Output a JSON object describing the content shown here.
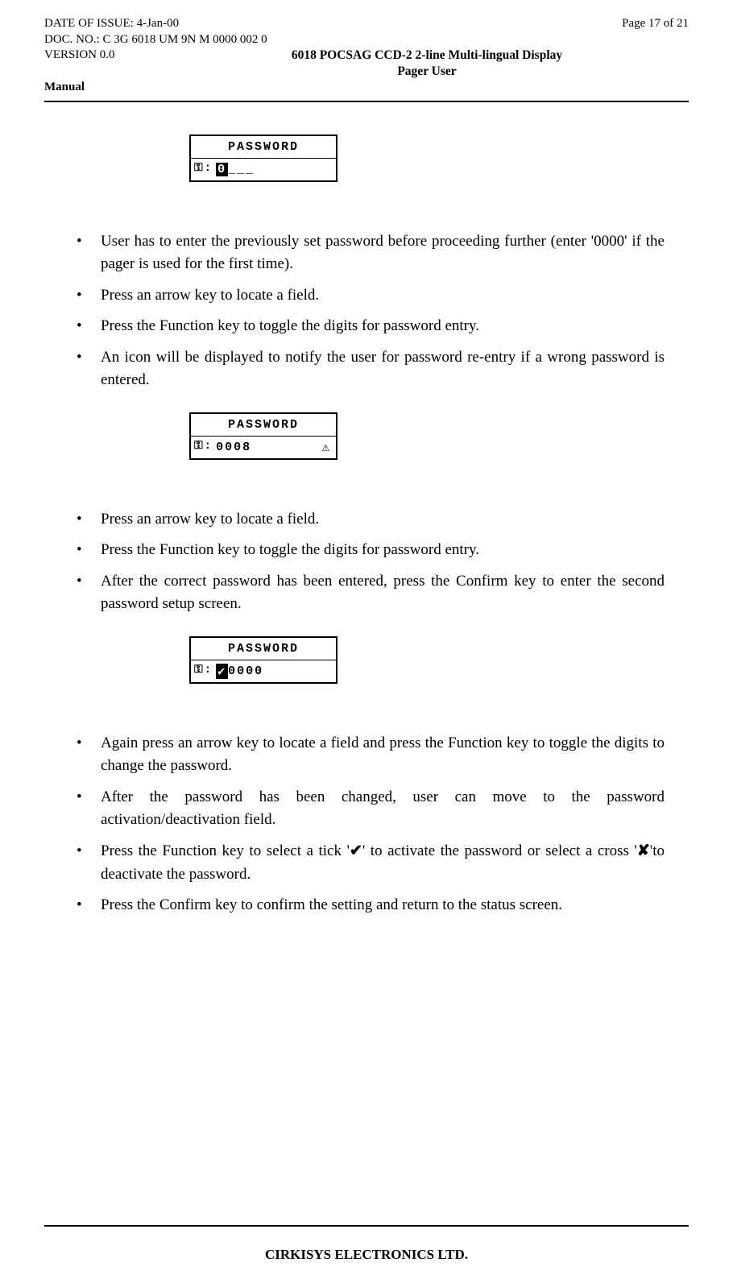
{
  "header": {
    "date_label": "DATE OF ISSUE: 4-Jan-00",
    "page_label": "Page 17 of 21",
    "doc_no": "DOC. NO.: C 3G 6018 UM 9N M 0000 002 0",
    "version": "VERSION 0.0",
    "title": "6018 POCSAG CCD-2 2-line Multi-lingual Display Pager User",
    "manual": "Manual"
  },
  "lcd1": {
    "top": "PASSWORD",
    "bottom_key": "⚿:",
    "bottom_val_inv": "0",
    "bottom_val_rest": "___"
  },
  "bullets1": {
    "b0": "User has to enter the previously set password before proceeding further (enter '0000' if the pager is used for the first time).",
    "b1": "Press an arrow key to locate a field.",
    "b2": "Press the Function key to toggle the digits for password entry.",
    "b3": "An icon will be displayed to notify the user for password re-entry if a wrong password is entered."
  },
  "lcd2": {
    "top": "PASSWORD",
    "bottom_key": "⚿:",
    "bottom_val": "0008",
    "warn": "⚠"
  },
  "bullets2": {
    "b0": "Press an arrow key to locate a field.",
    "b1": "Press the Function key to toggle the digits for password entry.",
    "b2": "After the correct password has been entered, press the Confirm key to enter the second password setup screen."
  },
  "lcd3": {
    "top": "PASSWORD",
    "bottom_key": "⚿:",
    "bottom_checkinv": "✔",
    "bottom_val": " 0000"
  },
  "bullets3": {
    "b0": "Again press an arrow key to locate a field and press the Function key to toggle the digits to change the password.",
    "b1": "After the password has been changed, user can move to the password activation/deactivation field.",
    "b2_part1": "Press the Function key to select a tick '",
    "b2_tick": "✔",
    "b2_part2": "' to activate the password or select a cross '",
    "b2_cross": "✘",
    "b2_part3": "'to deactivate the password.",
    "b3": "Press the Confirm key to confirm the setting and return to the status screen."
  },
  "footer": "CIRKISYS ELECTRONICS LTD."
}
